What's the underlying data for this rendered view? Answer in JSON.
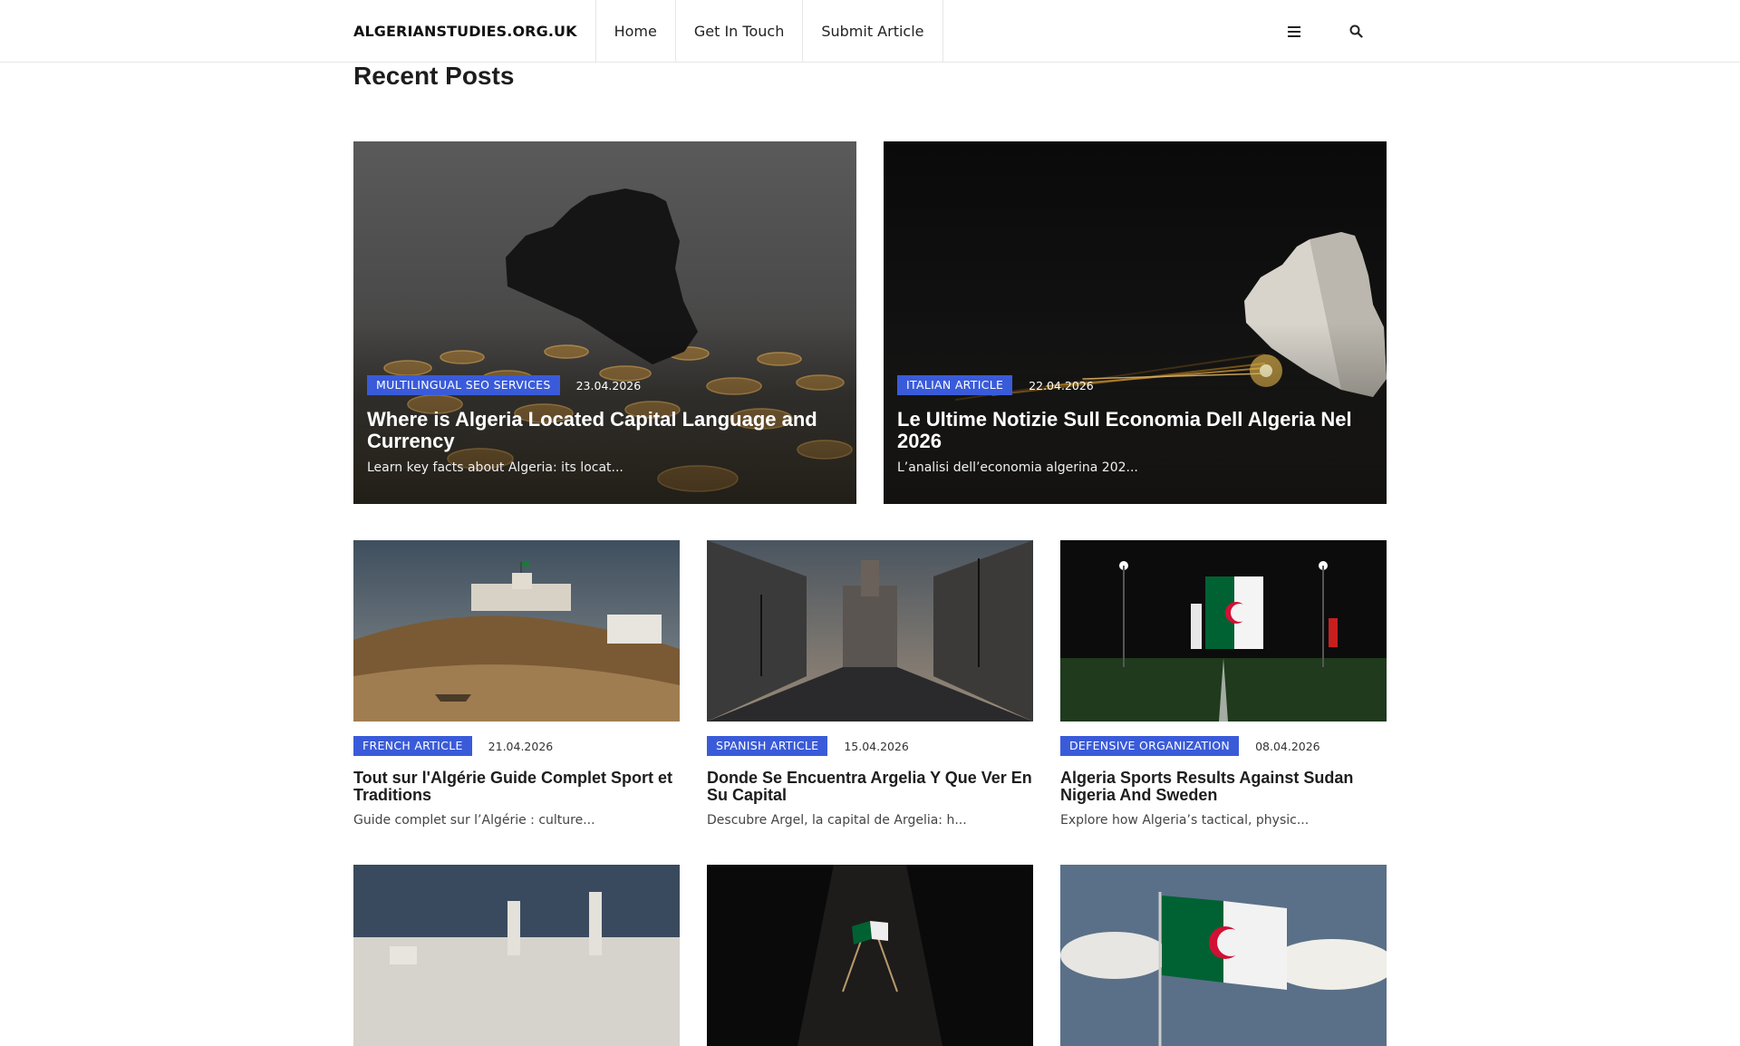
{
  "header": {
    "logo": "ALGERIANSTUDIES.ORG.UK",
    "nav": [
      {
        "label": "Home"
      },
      {
        "label": "Get In Touch"
      },
      {
        "label": "Submit Article"
      }
    ],
    "icons": [
      "menu-icon",
      "search-icon"
    ]
  },
  "section_title": "Recent Posts",
  "featured": [
    {
      "category": "MULTILINGUAL SEO SERVICES",
      "date": "23.04.2026",
      "title": "Where is Algeria Located Capital Language and Currency",
      "excerpt": "Learn key facts about Algeria: its locat...",
      "image": "algeria-map-silhouette-with-coins"
    },
    {
      "category": "ITALIAN ARTICLE",
      "date": "22.04.2026",
      "title": "Le Ultime Notizie Sull Economia Dell Algeria Nel 2026",
      "excerpt": "L’analisi dell’economia algerina 202...",
      "image": "algeria-map-with-light-trails"
    }
  ],
  "posts": [
    {
      "category": "FRENCH ARTICLE",
      "date": "21.04.2026",
      "title": "Tout sur l'Algérie Guide Complet Sport et Traditions",
      "excerpt": "Guide complet sur l’Algérie : culture...",
      "image": "desert-fortress-with-boat"
    },
    {
      "category": "SPANISH ARTICLE",
      "date": "15.04.2026",
      "title": "Donde Se Encuentra Argelia Y Que Ver En Su Capital",
      "excerpt": "Descubre Argel, la capital de Argelia: h...",
      "image": "city-street-at-dusk"
    },
    {
      "category": "DEFENSIVE ORGANIZATION",
      "date": "08.04.2026",
      "title": "Algeria Sports Results Against Sudan Nigeria And Sweden",
      "excerpt": "Explore how Algeria’s tactical, physic...",
      "image": "football-player-with-algerian-flag"
    },
    {
      "image": "white-city-skyline"
    },
    {
      "image": "algerian-flag-on-book"
    },
    {
      "image": "algerian-flag-waving"
    }
  ],
  "colors": {
    "accent": "#3a5bd9",
    "flag_green": "#006233",
    "flag_red": "#d21034"
  }
}
